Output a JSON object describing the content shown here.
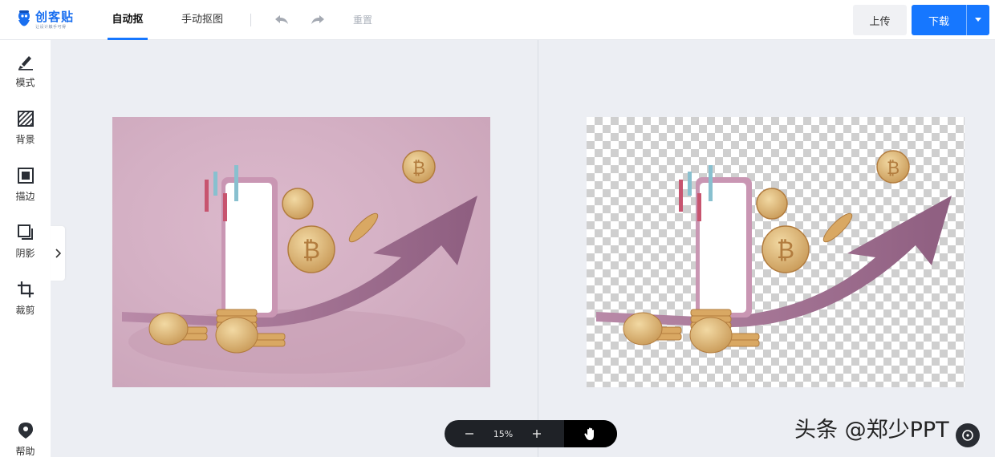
{
  "header": {
    "logo_name": "创客贴",
    "logo_tagline": "让设计触手可得",
    "tabs": [
      {
        "label": "自动抠图",
        "active": true
      },
      {
        "label": "手动抠图",
        "active": false
      }
    ],
    "reset_label": "重置",
    "upload_label": "上传",
    "download_label": "下载",
    "accent_color": "#1677ff"
  },
  "sidebar": {
    "items": [
      {
        "label": "模式",
        "icon": "brush-icon"
      },
      {
        "label": "背景",
        "icon": "background-hatch-icon"
      },
      {
        "label": "描边",
        "icon": "stroke-square-icon"
      },
      {
        "label": "阴影",
        "icon": "shadow-square-icon"
      },
      {
        "label": "裁剪",
        "icon": "crop-icon"
      }
    ],
    "help_label": "帮助"
  },
  "workspace": {
    "original_image": "pink-background-bitcoin-coins-smartphone-rising-arrow",
    "result_image": "cutout-bitcoin-coins-smartphone-rising-arrow-on-transparent-checkerboard"
  },
  "zoom": {
    "value": "15%"
  },
  "watermark": "头条 @郑少PPT"
}
